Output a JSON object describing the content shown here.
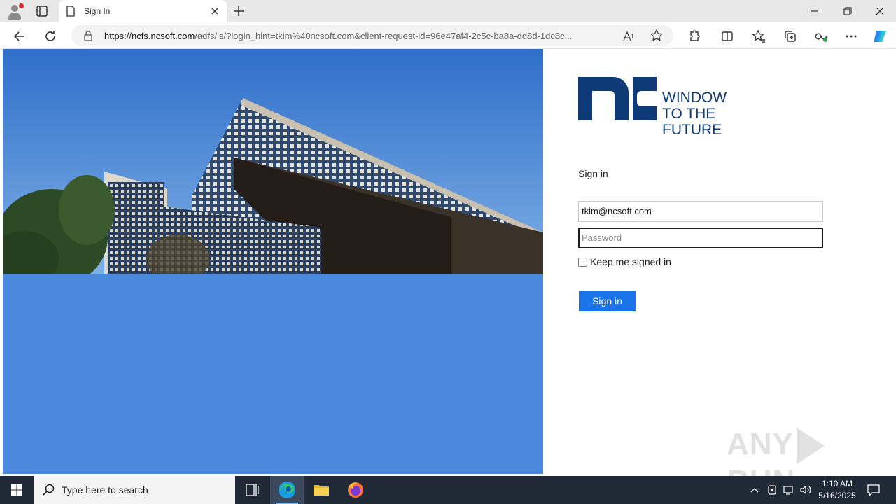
{
  "browser": {
    "tab_title": "Sign In",
    "url_host": "https://ncfs.ncsoft.com",
    "url_rest": "/adfs/ls/?login_hint=tkim%40ncsoft.com&client-request-id=96e47af4-2c5c-ba8a-dd8d-1dc8c...",
    "icons": [
      "profile-icon",
      "tab-actions-icon",
      "page-icon",
      "close-icon",
      "new-tab-icon",
      "minimize-icon",
      "restore-icon",
      "window-close-icon",
      "back-icon",
      "refresh-icon",
      "lock-icon",
      "read-aloud-icon",
      "favorite-star-icon",
      "extensions-icon",
      "split-screen-icon",
      "favorites-icon",
      "collections-icon",
      "browser-essentials-icon",
      "more-icon",
      "copilot-icon"
    ]
  },
  "login": {
    "logo_line1": "WINDOW",
    "logo_line2": "TO THE FUTURE",
    "heading": "Sign in",
    "username_value": "tkim@ncsoft.com",
    "password_placeholder": "Password",
    "keep_signed_in_label": "Keep me signed in",
    "submit_label": "Sign in"
  },
  "colors": {
    "illustration_bg": "#4a89dc",
    "button_bg": "#1a73e8",
    "logo_blue": "#0e3a78"
  },
  "watermark": {
    "left": "ANY",
    "right": "RUN"
  },
  "taskbar": {
    "search_placeholder": "Type here to search",
    "time": "1:10 AM",
    "date": "5/16/2025"
  }
}
